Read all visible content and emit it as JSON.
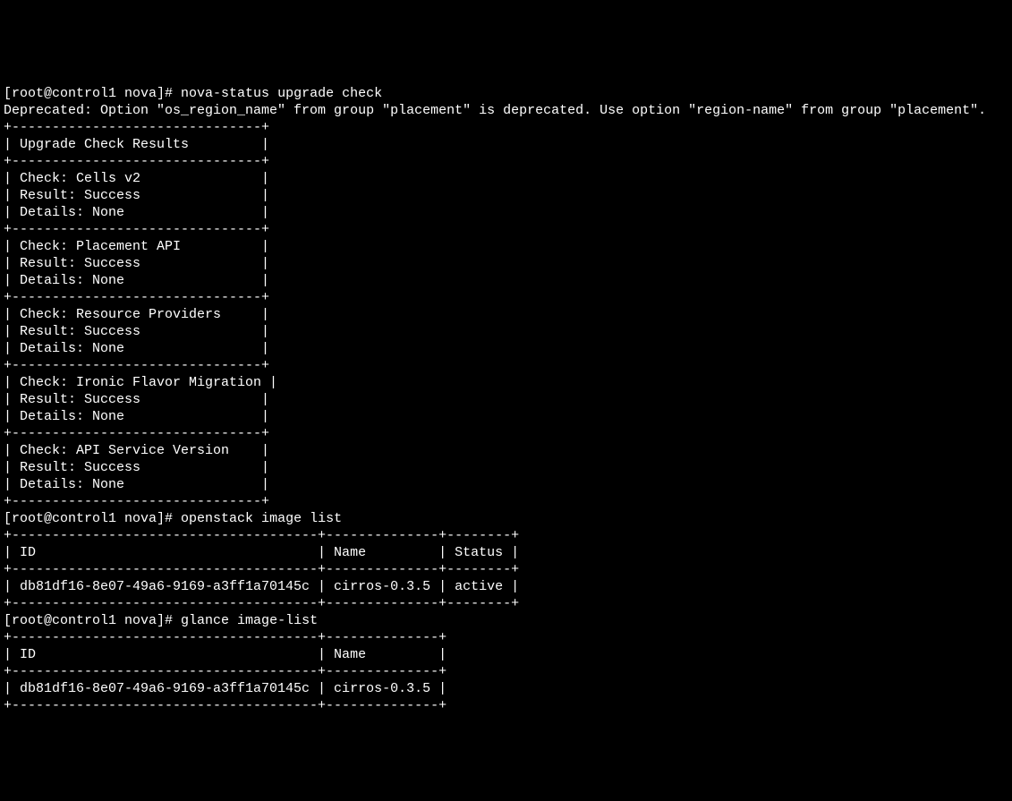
{
  "prompt": {
    "user": "root",
    "host": "control1",
    "cwd": "nova",
    "prefix": "[root@control1 nova]# "
  },
  "commands": {
    "c1": "nova-status upgrade check",
    "c2": "openstack image list",
    "c3": "glance image-list"
  },
  "deprecation_msg": "Deprecated: Option \"os_region_name\" from group \"placement\" is deprecated. Use option \"region-name\" from group \"placement\".",
  "upgrade_table": {
    "header": "| Upgrade Check Results         |",
    "sep": "+-------------------------------+",
    "checks": [
      {
        "name": "| Check: Cells v2               |",
        "result": "| Result: Success               |",
        "details": "| Details: None                 |"
      },
      {
        "name": "| Check: Placement API          |",
        "result": "| Result: Success               |",
        "details": "| Details: None                 |"
      },
      {
        "name": "| Check: Resource Providers     |",
        "result": "| Result: Success               |",
        "details": "| Details: None                 |"
      },
      {
        "name": "| Check: Ironic Flavor Migration |",
        "result": "| Result: Success               |",
        "details": "| Details: None                 |"
      },
      {
        "name": "| Check: API Service Version    |",
        "result": "| Result: Success               |",
        "details": "| Details: None                 |"
      }
    ]
  },
  "image_table": {
    "sep": "+--------------------------------------+--------------+--------+",
    "header": "| ID                                   | Name         | Status |",
    "rows": [
      "| db81df16-8e07-49a6-9169-a3ff1a70145c | cirros-0.3.5 | active |"
    ]
  },
  "glance_table": {
    "sep": "+--------------------------------------+--------------+",
    "header": "| ID                                   | Name         |",
    "rows": [
      "| db81df16-8e07-49a6-9169-a3ff1a70145c | cirros-0.3.5 |"
    ]
  },
  "structured": {
    "upgrade_checks": [
      {
        "check": "Cells v2",
        "result": "Success",
        "details": "None"
      },
      {
        "check": "Placement API",
        "result": "Success",
        "details": "None"
      },
      {
        "check": "Resource Providers",
        "result": "Success",
        "details": "None"
      },
      {
        "check": "Ironic Flavor Migration",
        "result": "Success",
        "details": "None"
      },
      {
        "check": "API Service Version",
        "result": "Success",
        "details": "None"
      }
    ],
    "images": [
      {
        "id": "db81df16-8e07-49a6-9169-a3ff1a70145c",
        "name": "cirros-0.3.5",
        "status": "active"
      }
    ]
  }
}
